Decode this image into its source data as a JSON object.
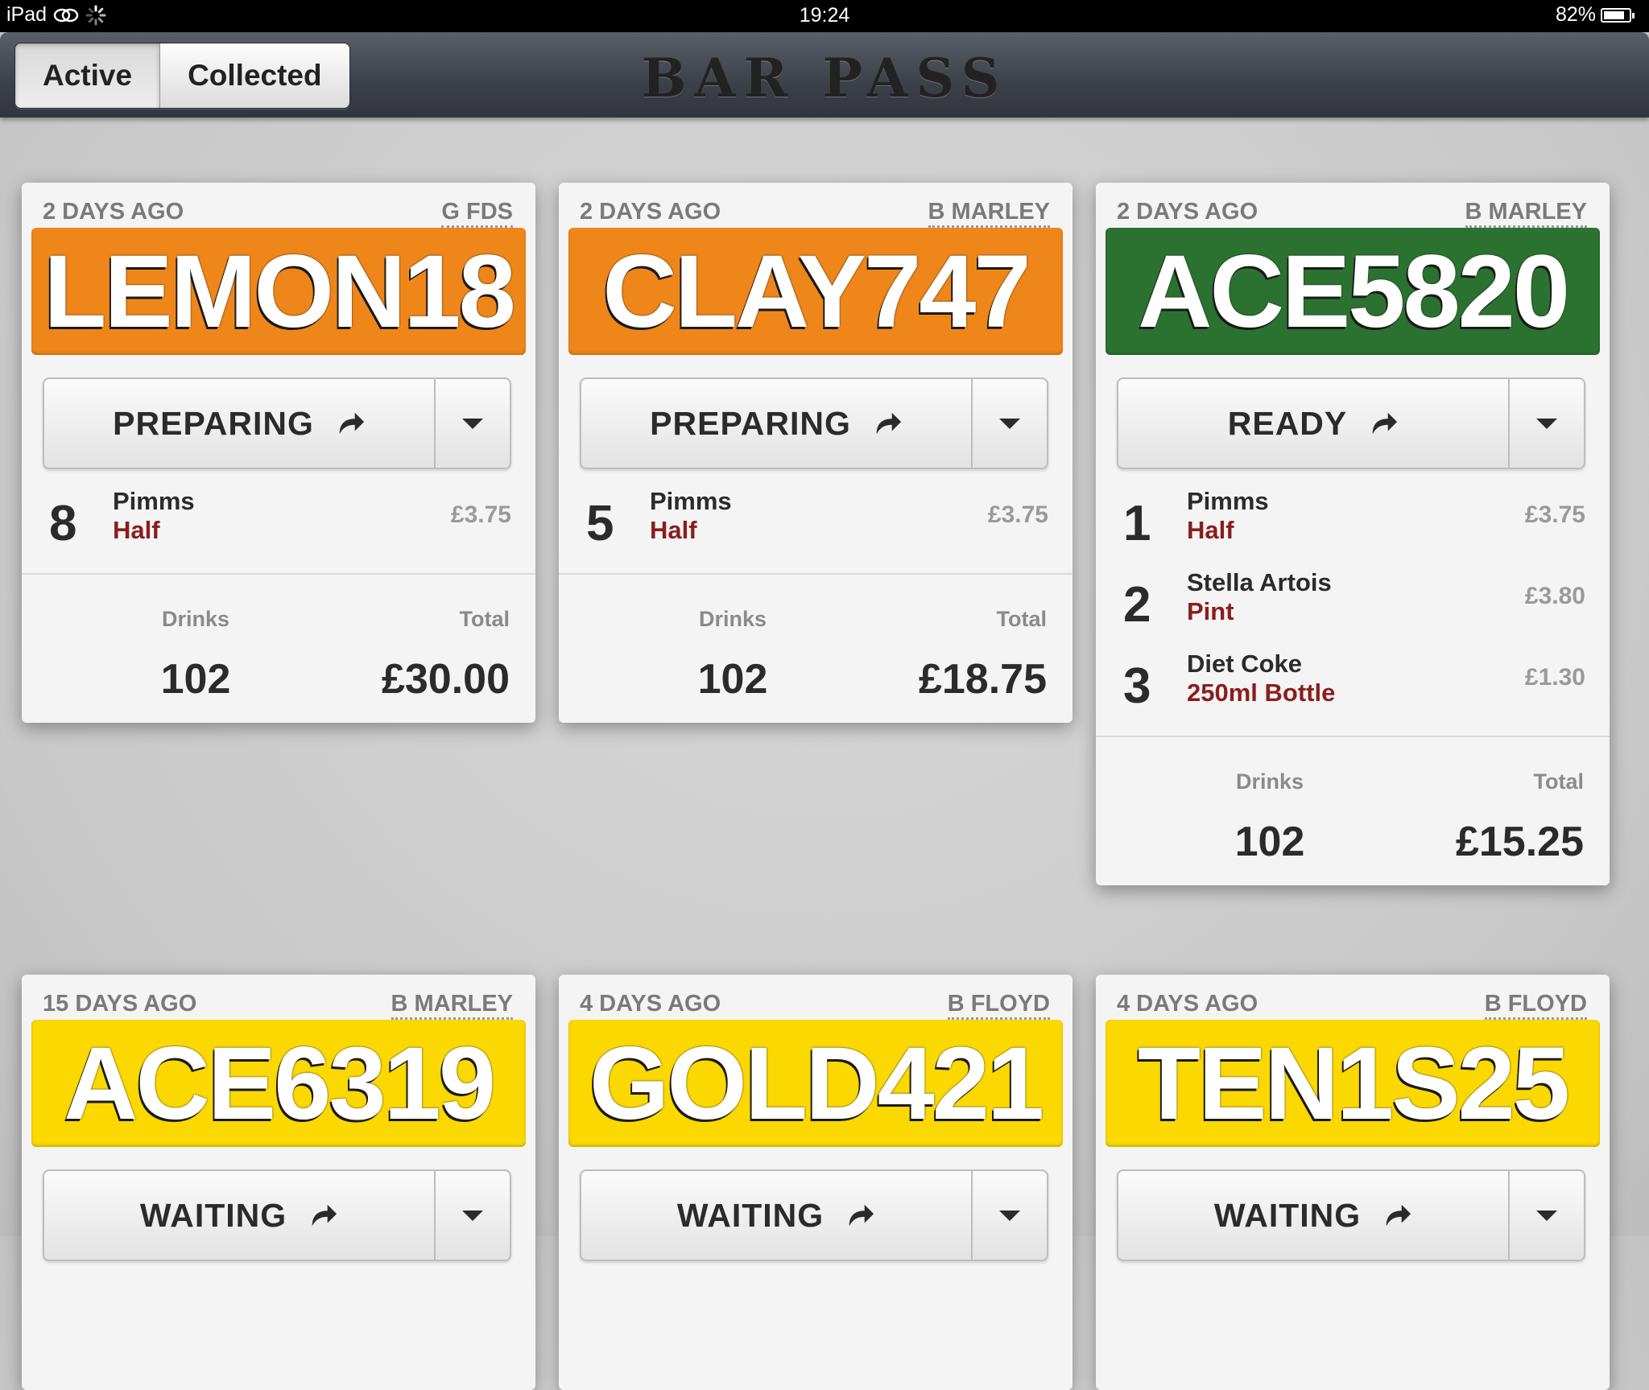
{
  "status_bar": {
    "device": "iPad",
    "time": "19:24",
    "battery": "82%",
    "battery_level": 0.82
  },
  "header": {
    "title": "BAR PASS",
    "tabs": [
      {
        "label": "Active",
        "selected": true
      },
      {
        "label": "Collected",
        "selected": false
      }
    ]
  },
  "colors": {
    "orange": "#ef8619",
    "green": "#2b7231",
    "yellow": "#fbd800"
  },
  "orders": [
    {
      "time": "2 DAYS AGO",
      "user": "G FDS",
      "code": "LEMON18",
      "color": "#ef8619",
      "status": "PREPARING",
      "items": [
        {
          "qty": "8",
          "name": "Pimms",
          "size": "Half",
          "price": "£3.75"
        }
      ],
      "drinks_label": "Drinks",
      "drinks": "102",
      "total_label": "Total",
      "total": "£30.00"
    },
    {
      "time": "2 DAYS AGO",
      "user": "B MARLEY",
      "code": "CLAY747",
      "color": "#ef8619",
      "status": "PREPARING",
      "items": [
        {
          "qty": "5",
          "name": "Pimms",
          "size": "Half",
          "price": "£3.75"
        }
      ],
      "drinks_label": "Drinks",
      "drinks": "102",
      "total_label": "Total",
      "total": "£18.75"
    },
    {
      "time": "2 DAYS AGO",
      "user": "B MARLEY",
      "code": "ACE5820",
      "color": "#2b7231",
      "status": "READY",
      "items": [
        {
          "qty": "1",
          "name": "Pimms",
          "size": "Half",
          "price": "£3.75"
        },
        {
          "qty": "2",
          "name": "Stella Artois",
          "size": "Pint",
          "price": "£3.80"
        },
        {
          "qty": "3",
          "name": "Diet Coke",
          "size": "250ml Bottle",
          "price": "£1.30"
        }
      ],
      "drinks_label": "Drinks",
      "drinks": "102",
      "total_label": "Total",
      "total": "£15.25"
    },
    {
      "time": "15 DAYS AGO",
      "user": "B MARLEY",
      "code": "ACE6319",
      "color": "#fbd800",
      "status": "WAITING"
    },
    {
      "time": "4 DAYS AGO",
      "user": "B FLOYD",
      "code": "GOLD421",
      "color": "#fbd800",
      "status": "WAITING"
    },
    {
      "time": "4 DAYS AGO",
      "user": "B FLOYD",
      "code": "TEN1S25",
      "color": "#fbd800",
      "status": "WAITING"
    }
  ]
}
